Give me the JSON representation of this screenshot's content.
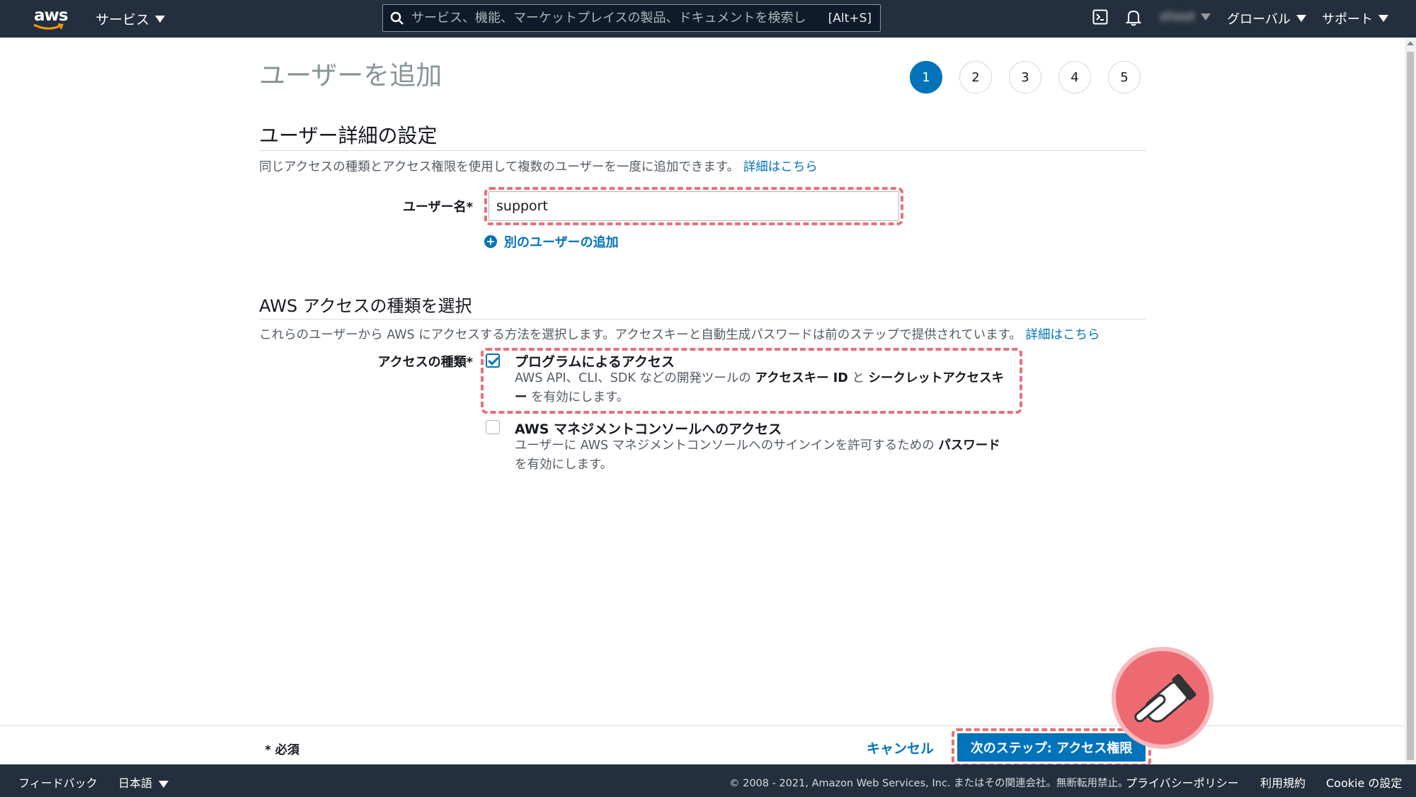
{
  "topbar": {
    "logo_text": "aws",
    "services_label": "サービス",
    "search_placeholder": "サービス、機能、マーケットプレイスの製品、ドキュメントを検索し",
    "search_shortcut": "[Alt+S]",
    "account_label": "shoot",
    "region_label": "グローバル",
    "support_label": "サポート"
  },
  "page": {
    "title": "ユーザーを追加",
    "steps": [
      "1",
      "2",
      "3",
      "4",
      "5"
    ],
    "active_step": "1"
  },
  "details": {
    "title": "ユーザー詳細の設定",
    "description": "同じアクセスの種類とアクセス権限を使用して複数のユーザーを一度に追加できます。",
    "more_link": "詳細はこちら",
    "username_label": "ユーザー名*",
    "username_value": "support",
    "add_user_link": "別のユーザーの追加"
  },
  "access": {
    "title": "AWS アクセスの種類を選択",
    "description": "これらのユーザーから AWS にアクセスする方法を選択します。アクセスキーと自動生成パスワードは前のステップで提供されています。",
    "more_link": "詳細はこちら",
    "type_label": "アクセスの種類*",
    "options": [
      {
        "title": "プログラムによるアクセス",
        "checked": true,
        "desc_1": "AWS API、CLI、SDK などの開発ツールの",
        "desc_b1": "アクセスキー ID",
        "desc_2": " と ",
        "desc_b2": "シークレットアクセスキー",
        "desc_3": " を有効にします。"
      },
      {
        "title": "AWS マネジメントコンソールへのアクセス",
        "checked": false,
        "desc_1": "ユーザーに AWS マネジメントコンソールへのサインインを許可するための ",
        "desc_b1": "パスワード",
        "desc_2": " を有効にします。"
      }
    ]
  },
  "actions": {
    "required_note": "* 必須",
    "cancel_label": "キャンセル",
    "next_label": "次のステップ: アクセス権限"
  },
  "footer": {
    "feedback": "フィードバック",
    "language": "日本語",
    "copyright": "© 2008 - 2021, Amazon Web Services, Inc. またはその関連会社。無断転用禁止。",
    "privacy": "プライバシーポリシー",
    "terms": "利用規約",
    "cookie": "Cookie の設定"
  },
  "colors": {
    "nav_bg": "#232f3e",
    "link": "#0073bb",
    "highlight": "#e8707a",
    "aws_orange": "#ff9900"
  }
}
